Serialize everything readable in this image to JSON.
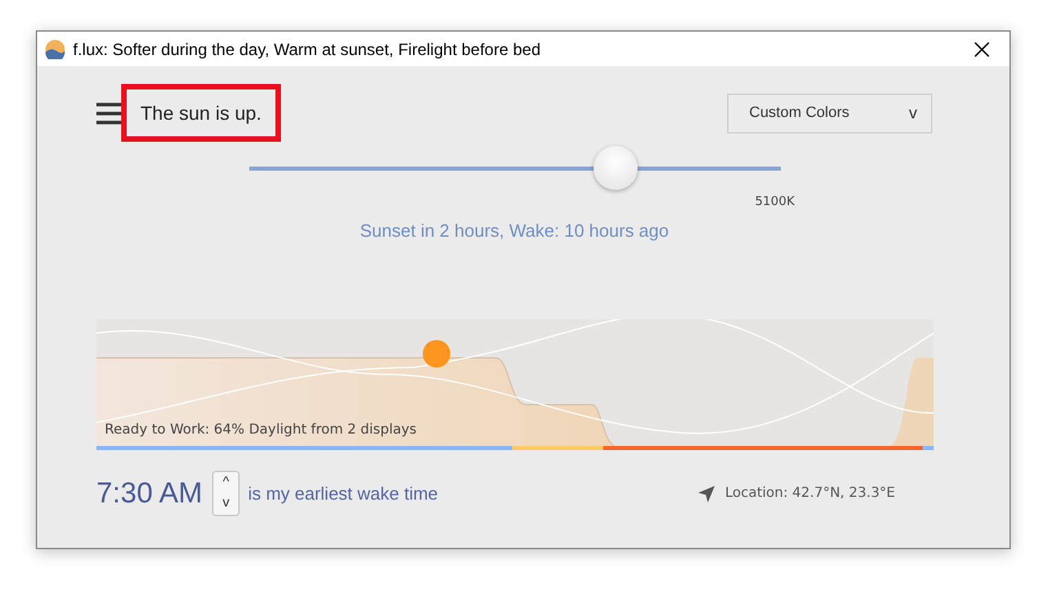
{
  "window": {
    "title": "f.lux: Softer during the day, Warm at sunset, Firelight before bed"
  },
  "status": {
    "text": "The sun is up.",
    "highlighted": true
  },
  "color_dropdown": {
    "value": "Custom Colors",
    "caret": "v"
  },
  "temperature_slider": {
    "level": 0.69,
    "reading": "5100K"
  },
  "schedule_text": "Sunset in 2 hours, Wake: 10 hours ago",
  "graph": {
    "caption": "Ready to Work: 64% Daylight from 2 displays"
  },
  "wake": {
    "time": "7:30 AM",
    "up": "^",
    "down": "v",
    "label": "is my earliest wake time"
  },
  "location": {
    "text": "Location: 42.7°N, 23.3°E"
  }
}
